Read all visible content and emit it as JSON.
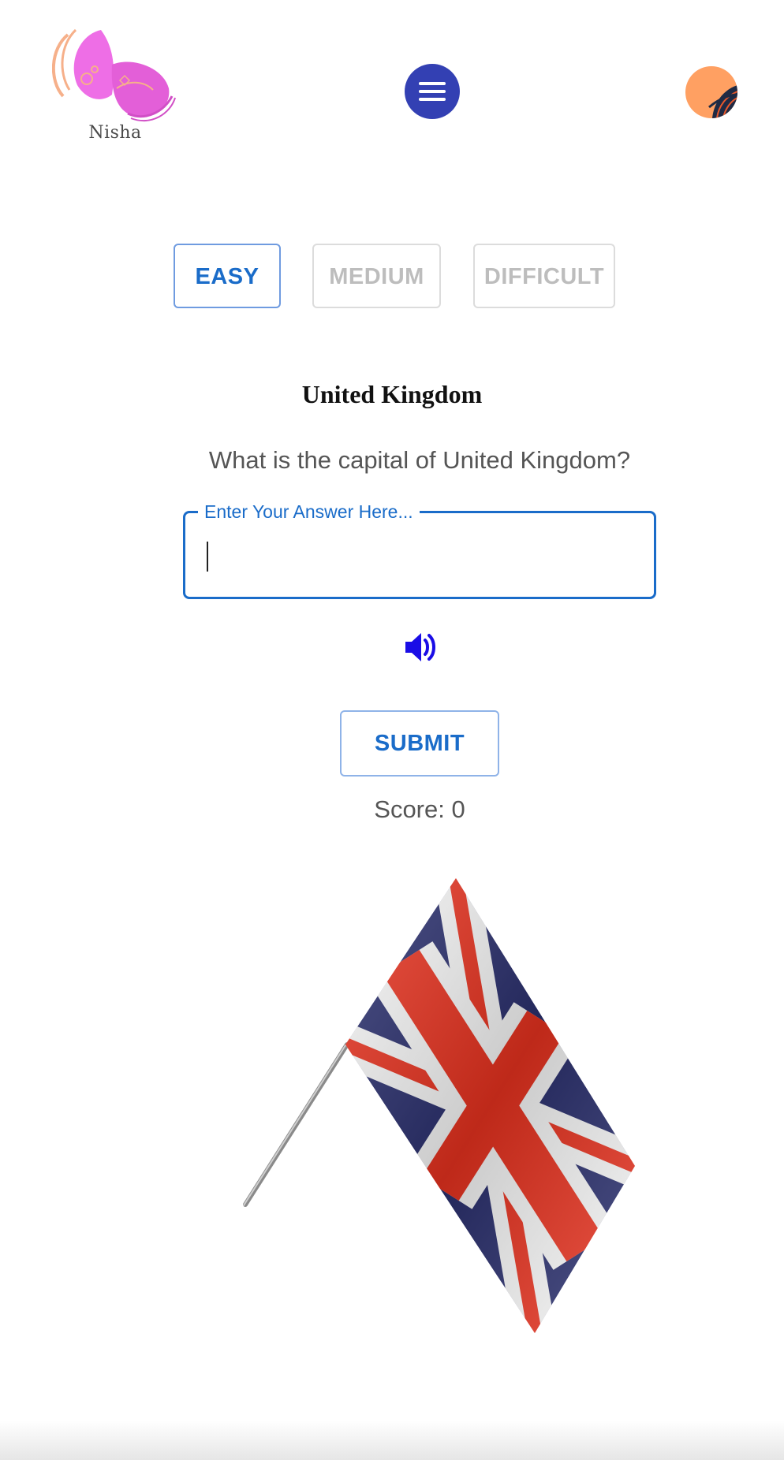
{
  "header": {
    "logo_text": "Nisha",
    "menu_icon": "hamburger-menu-icon",
    "avatar_icon": "user-avatar-icon"
  },
  "levels": {
    "easy": "EASY",
    "medium": "MEDIUM",
    "difficult": "DIFFICULT",
    "selected": "EASY"
  },
  "quiz": {
    "country": "United Kingdom",
    "question": "What is the capital of United Kingdom?",
    "answer_label": "Enter Your Answer Here...",
    "answer_value": "",
    "speaker_icon": "volume-icon",
    "submit_label": "SUBMIT",
    "score_text": "Score: 0"
  },
  "flag": {
    "icon": "union-jack-flag",
    "colors": {
      "blue": "#2a2f6e",
      "red": "#e8321f",
      "white": "#f7f7f7"
    }
  },
  "colors": {
    "accent": "#1a6cc9",
    "menu_bg": "#3340b3",
    "avatar_bg": "#ffa062",
    "logo_pink": "#e35fd8",
    "disabled_text": "#bdbdbd",
    "speaker": "#1a0de6"
  }
}
